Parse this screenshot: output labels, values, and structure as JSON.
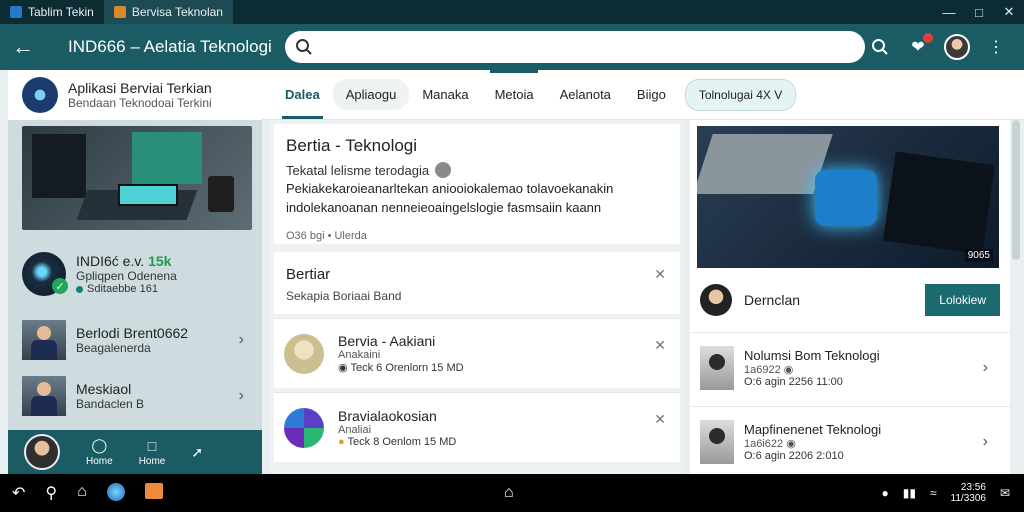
{
  "window": {
    "tabs": [
      {
        "label": "Tablim Tekin",
        "icon": "app-icon"
      },
      {
        "label": "Bervisa Teknolan",
        "icon": "app-icon"
      }
    ]
  },
  "appbar": {
    "title": "IND666 – Aelatia Teknologin",
    "search_placeholder": ""
  },
  "left": {
    "header": {
      "title": "Aplikasi Berviai Terkian",
      "subtitle": "Bendaan Teknodoai Terkini"
    },
    "profile": {
      "title": "INDI6ć e.v.",
      "title_accent": "15k",
      "subtitle": "Gpliqpen Odenena",
      "meta": "Sditaebbe 161"
    },
    "nav": [
      {
        "title": "Berlodi Brent0662",
        "subtitle": "Beagalenerda"
      },
      {
        "title": "Meskiaol",
        "subtitle": "Bandaclen B"
      }
    ],
    "bottom": [
      {
        "label": "Home",
        "icon": "chat-bubble-icon"
      },
      {
        "label": "Home",
        "icon": "square-icon"
      }
    ]
  },
  "tabs": [
    {
      "label": "Dalea",
      "active": true
    },
    {
      "label": "Apliaogu"
    },
    {
      "label": "Manaka"
    },
    {
      "label": "Metoia"
    },
    {
      "label": "Aelanota"
    },
    {
      "label": "Biigo"
    },
    {
      "label": "Tolnolugai 4X V"
    }
  ],
  "main": {
    "card1": {
      "title": "Bertia - Teknologi",
      "subtitle": "Tekatal lelisme terodagia",
      "desc1": "Pekiakekaroieanarltekan aniooiokalemao tolavoekanakin",
      "desc2": "indolekanoanan nenneieoaingelslogie fasmsaiin kaann",
      "meta": "O36 bgi • Ulerda"
    },
    "card2": {
      "title": "Bertiar",
      "subtitle": "Sekapia Boriaai Band"
    },
    "rows": [
      {
        "title": "Bervia - Aakiani",
        "subtitle": "Anakaini",
        "meta": "Teck 6 Orenlorn 15 MD"
      },
      {
        "title": "Bravialaokosian",
        "subtitle": "Analiai",
        "meta": "Teck 8 Oenlom 15 MD"
      }
    ]
  },
  "right": {
    "hero_count": "9065",
    "author": {
      "name": "Dernclan",
      "follow_label": "Lolokiew"
    },
    "news": [
      {
        "title": "Nolumsi Bom Teknologi",
        "subtitle": "1a6922",
        "meta": "O:6 agin 2256 11:00"
      },
      {
        "title": "Mapfinenenet Teknologi",
        "subtitle": "1a6i622",
        "meta": "O:6 agin 2206 2:010"
      }
    ]
  },
  "taskbar": {
    "time": "23:56",
    "date": "11/3306"
  },
  "colors": {
    "appbar": "#1a5b64",
    "titlebar": "#0d2b33",
    "accent": "#1a6a70"
  }
}
